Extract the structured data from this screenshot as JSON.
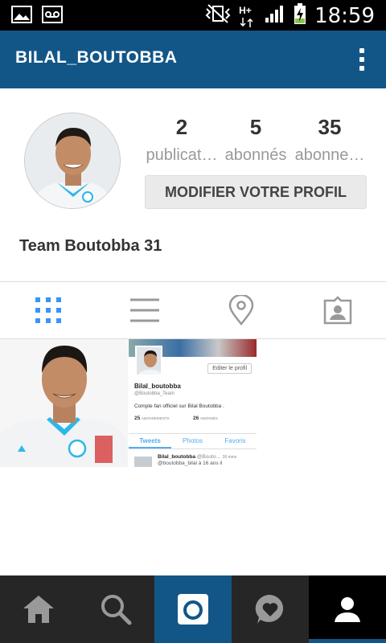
{
  "status_bar": {
    "time": "18:59",
    "network": "H+",
    "icons": [
      "image-icon",
      "voicemail-icon",
      "vibrate-mute-icon",
      "signal-icon",
      "battery-charging-icon"
    ]
  },
  "app_bar": {
    "title": "BILAL_BOUTOBBA",
    "menu_icon": "more-vertical-icon",
    "background": "#125688"
  },
  "profile": {
    "stats": [
      {
        "value": "2",
        "label": "publicat…"
      },
      {
        "value": "5",
        "label": "abonnés"
      },
      {
        "value": "35",
        "label": "abonne…"
      }
    ],
    "edit_button": "MODIFIER VOTRE PROFIL",
    "full_name": "Team Boutobba 31"
  },
  "view_tabs": [
    {
      "name": "grid-view",
      "icon": "grid-icon",
      "active": true
    },
    {
      "name": "list-view",
      "icon": "list-icon",
      "active": false
    },
    {
      "name": "map-view",
      "icon": "location-pin-icon",
      "active": false
    },
    {
      "name": "tagged-view",
      "icon": "tagged-photo-icon",
      "active": false
    }
  ],
  "posts": {
    "twitter_screenshot": {
      "edit_label": "Editer le profil",
      "name": "Bilal_boutobba",
      "handle": "@Boutobba_Team",
      "bio": "Compte fan officiel sur Bilal Boutobba .",
      "following_count": "25",
      "following_label": "ABONNEMENTS",
      "followers_count": "26",
      "followers_label": "ABONNÉS",
      "tabs": [
        "Tweets",
        "Photos",
        "Favoris"
      ],
      "tweet_author": "Bilal_boutobba",
      "tweet_handle": "@Bouto…",
      "tweet_time": "36 mins",
      "tweet_text": "@boutobba_bilal à 16 ans il"
    }
  },
  "bottom_nav": [
    {
      "name": "home",
      "icon": "home-icon",
      "active": false
    },
    {
      "name": "search",
      "icon": "search-icon",
      "active": false
    },
    {
      "name": "camera",
      "icon": "camera-icon",
      "active": false
    },
    {
      "name": "activity",
      "icon": "heart-bubble-icon",
      "active": false
    },
    {
      "name": "profile",
      "icon": "person-icon",
      "active": true
    }
  ],
  "colors": {
    "accent": "#125688",
    "grid_active": "#3897f0",
    "nav_background": "#262626"
  }
}
